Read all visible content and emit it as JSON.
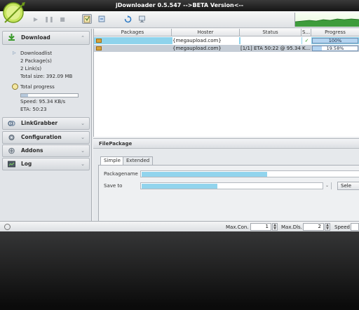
{
  "window": {
    "title": "jDownloader 0.5.547 -->BETA Version<--"
  },
  "toolbar": {
    "icons": [
      "play-icon",
      "pause-icon",
      "stop-icon",
      "clipboard-icon",
      "reconnect-icon",
      "update-icon",
      "network-icon"
    ]
  },
  "sidebar": {
    "download": {
      "label": "Download",
      "downloadlist_label": "Downloadlist",
      "packages": "2 Package(s)",
      "links": "2 Link(s)",
      "total_size": "Total size: 392.09 MB",
      "total_progress_label": "Total progress",
      "total_progress_value": 0.12,
      "speed": "Speed: 95.34 KB/s",
      "eta": "ETA: 50:23"
    },
    "sections": [
      {
        "label": "LinkGrabber"
      },
      {
        "label": "Configuration"
      },
      {
        "label": "Addons"
      },
      {
        "label": "Log"
      }
    ]
  },
  "table": {
    "columns": [
      "Packages",
      "Hoster",
      "Status",
      "S...",
      "Progress"
    ],
    "rows": [
      {
        "hoster": "{megaupload.com}",
        "status": "",
        "progress_label": "100%",
        "progress": 1.0,
        "done": true
      },
      {
        "hoster": "{megaupload.com}",
        "status": "[1/1] ETA 50:22 @ 95.34 K...",
        "progress_label": "19.58%",
        "progress": 0.1958,
        "done": false
      }
    ]
  },
  "filepackage": {
    "title": "FilePackage",
    "tabs": [
      "Simple",
      "Extended"
    ],
    "packagename_label": "Packagename",
    "saveto_label": "Save to",
    "select_button": "Sele"
  },
  "statusbar": {
    "maxcon_label": "Max.Con.",
    "maxcon_value": "1",
    "maxdls_label": "Max.Dls.",
    "maxdls_value": "2",
    "speed_label": "Speed"
  },
  "colors": {
    "highlight_row": "#8ed3ec",
    "selected_row": "#c5cdd6",
    "progress": "#b4d4f0",
    "check": "#2a9a1f"
  }
}
